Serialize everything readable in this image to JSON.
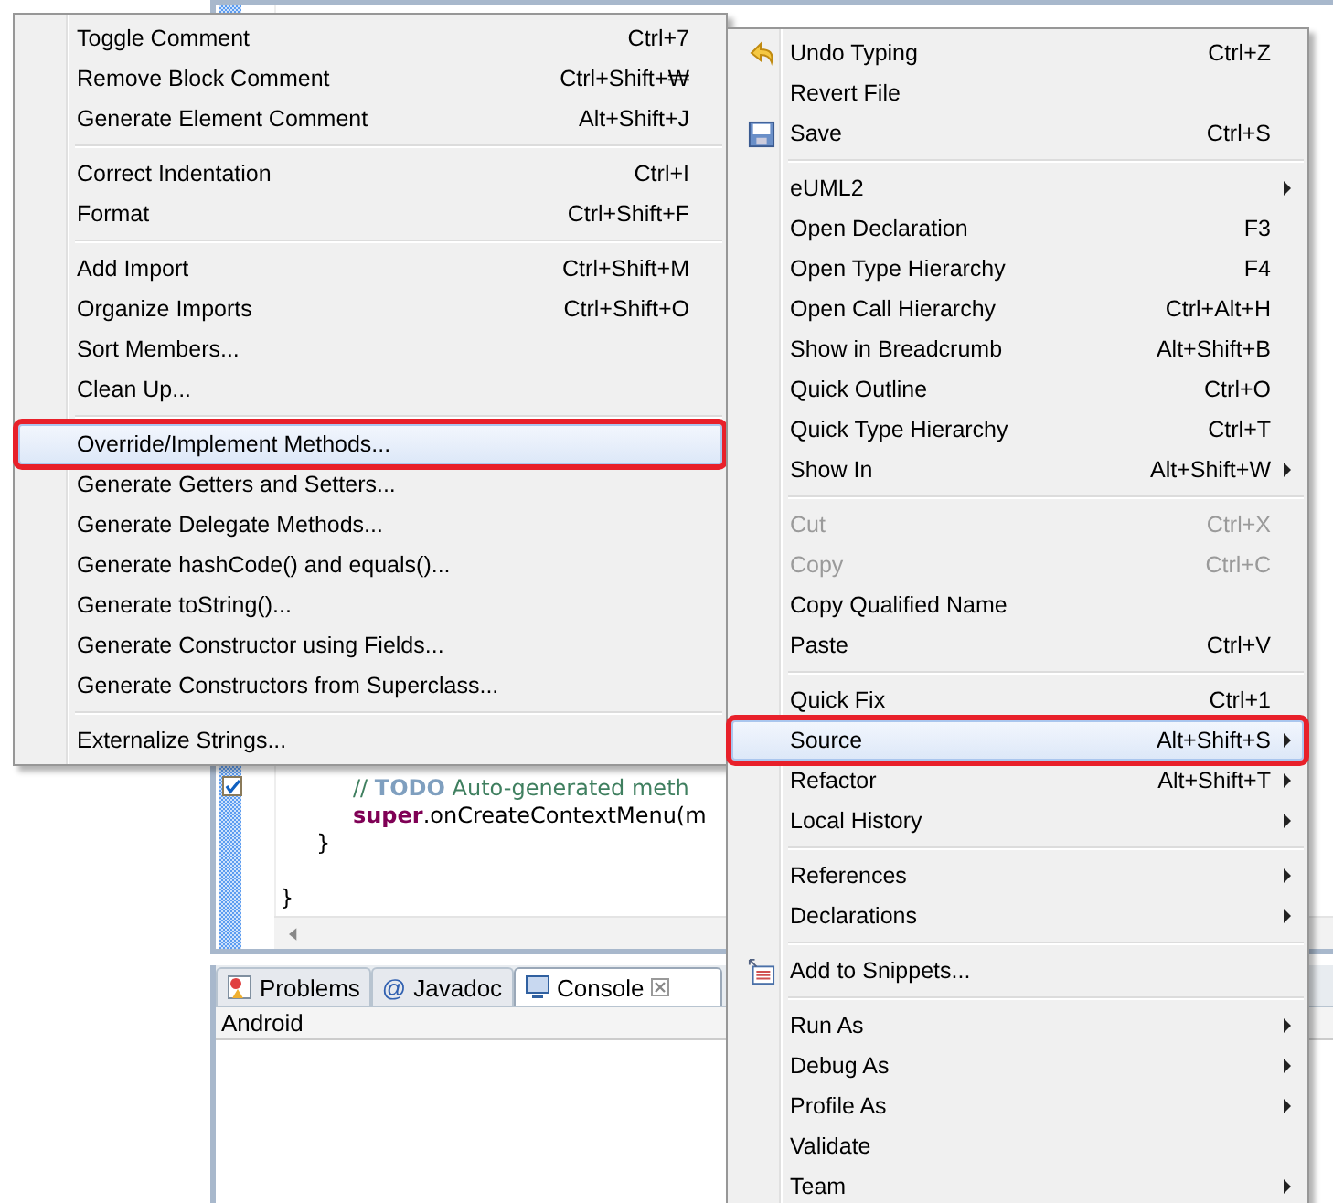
{
  "editor": {
    "lines": [
      {
        "children": [
          {
            "children": [
              {
                "segments": [
                  {
                    "kind": "comment",
                    "text": "// "
                  },
                  {
                    "kind": "todo",
                    "text": "TODO"
                  },
                  {
                    "kind": "comment",
                    "text": " Auto-generated meth"
                  }
                ],
                "marker": true
              },
              {
                "segments": [
                  {
                    "kind": "keyword",
                    "text": "super"
                  },
                  {
                    "kind": "plain",
                    "text": ".onCreateContextMenu(m"
                  }
                ]
              }
            ]
          },
          {
            "segments": [
              {
                "kind": "plain",
                "text": "}"
              }
            ]
          }
        ]
      },
      {
        "segments": [
          {
            "kind": "plain",
            "text": "}"
          }
        ]
      }
    ]
  },
  "bottom_panel": {
    "tabs": [
      {
        "label": "Problems",
        "selected": false
      },
      {
        "label": "Javadoc",
        "glyph": "@",
        "selected": false
      },
      {
        "label": "Console",
        "selected": true,
        "closable": true
      }
    ],
    "toolbar_label": "Android"
  },
  "source_menu": {
    "sections": [
      [
        {
          "label": "Toggle Comment",
          "shortcut": "Ctrl+7",
          "selected": false
        },
        {
          "label": "Remove Block Comment",
          "shortcut": "Ctrl+Shift+₩",
          "selected": false
        },
        {
          "label": "Generate Element Comment",
          "shortcut": "Alt+Shift+J",
          "selected": false
        }
      ],
      [
        {
          "label": "Correct Indentation",
          "shortcut": "Ctrl+I",
          "selected": false
        },
        {
          "label": "Format",
          "shortcut": "Ctrl+Shift+F",
          "selected": false
        }
      ],
      [
        {
          "label": "Add Import",
          "shortcut": "Ctrl+Shift+M",
          "selected": false
        },
        {
          "label": "Organize Imports",
          "shortcut": "Ctrl+Shift+O",
          "selected": false
        },
        {
          "label": "Sort Members...",
          "selected": false
        },
        {
          "label": "Clean Up...",
          "selected": false
        }
      ],
      [
        {
          "label": "Override/Implement Methods...",
          "selected": true
        },
        {
          "label": "Generate Getters and Setters...",
          "selected": false
        },
        {
          "label": "Generate Delegate Methods...",
          "selected": false
        },
        {
          "label": "Generate hashCode() and equals()...",
          "selected": false
        },
        {
          "label": "Generate toString()...",
          "selected": false
        },
        {
          "label": "Generate Constructor using Fields...",
          "selected": false
        },
        {
          "label": "Generate Constructors from Superclass...",
          "selected": false
        }
      ],
      [
        {
          "label": "Externalize Strings...",
          "selected": false
        }
      ]
    ]
  },
  "context_menu": {
    "sections": [
      [
        {
          "label": "Undo Typing",
          "shortcut": "Ctrl+Z",
          "selected": false,
          "disabled": false
        },
        {
          "label": "Revert File",
          "selected": false,
          "disabled": false
        },
        {
          "label": "Save",
          "shortcut": "Ctrl+S",
          "selected": false,
          "disabled": false
        }
      ],
      [
        {
          "label": "eUML2",
          "submenu": true,
          "selected": false,
          "disabled": false
        },
        {
          "label": "Open Declaration",
          "shortcut": "F3",
          "selected": false,
          "disabled": false
        },
        {
          "label": "Open Type Hierarchy",
          "shortcut": "F4",
          "selected": false,
          "disabled": false
        },
        {
          "label": "Open Call Hierarchy",
          "shortcut": "Ctrl+Alt+H",
          "selected": false,
          "disabled": false
        },
        {
          "label": "Show in Breadcrumb",
          "shortcut": "Alt+Shift+B",
          "selected": false,
          "disabled": false
        },
        {
          "label": "Quick Outline",
          "shortcut": "Ctrl+O",
          "selected": false,
          "disabled": false
        },
        {
          "label": "Quick Type Hierarchy",
          "shortcut": "Ctrl+T",
          "selected": false,
          "disabled": false
        },
        {
          "label": "Show In",
          "shortcut": "Alt+Shift+W",
          "submenu": true,
          "selected": false,
          "disabled": false
        }
      ],
      [
        {
          "label": "Cut",
          "shortcut": "Ctrl+X",
          "selected": false,
          "disabled": true
        },
        {
          "label": "Copy",
          "shortcut": "Ctrl+C",
          "selected": false,
          "disabled": true
        },
        {
          "label": "Copy Qualified Name",
          "selected": false,
          "disabled": false
        },
        {
          "label": "Paste",
          "shortcut": "Ctrl+V",
          "selected": false,
          "disabled": false
        }
      ],
      [
        {
          "label": "Quick Fix",
          "shortcut": "Ctrl+1",
          "selected": false,
          "disabled": false
        },
        {
          "label": "Source",
          "shortcut": "Alt+Shift+S",
          "submenu": true,
          "selected": true,
          "disabled": false
        },
        {
          "label": "Refactor",
          "shortcut": "Alt+Shift+T",
          "submenu": true,
          "selected": false,
          "disabled": false
        },
        {
          "label": "Local History",
          "submenu": true,
          "selected": false,
          "disabled": false
        }
      ],
      [
        {
          "label": "References",
          "submenu": true,
          "selected": false,
          "disabled": false
        },
        {
          "label": "Declarations",
          "submenu": true,
          "selected": false,
          "disabled": false
        }
      ],
      [
        {
          "label": "Add to Snippets...",
          "selected": false,
          "disabled": false
        }
      ],
      [
        {
          "label": "Run As",
          "submenu": true,
          "selected": false,
          "disabled": false
        },
        {
          "label": "Debug As",
          "submenu": true,
          "selected": false,
          "disabled": false
        },
        {
          "label": "Profile As",
          "submenu": true,
          "selected": false,
          "disabled": false
        },
        {
          "label": "Validate",
          "selected": false,
          "disabled": false
        },
        {
          "label": "Team",
          "submenu": true,
          "selected": false,
          "disabled": false
        }
      ]
    ]
  }
}
